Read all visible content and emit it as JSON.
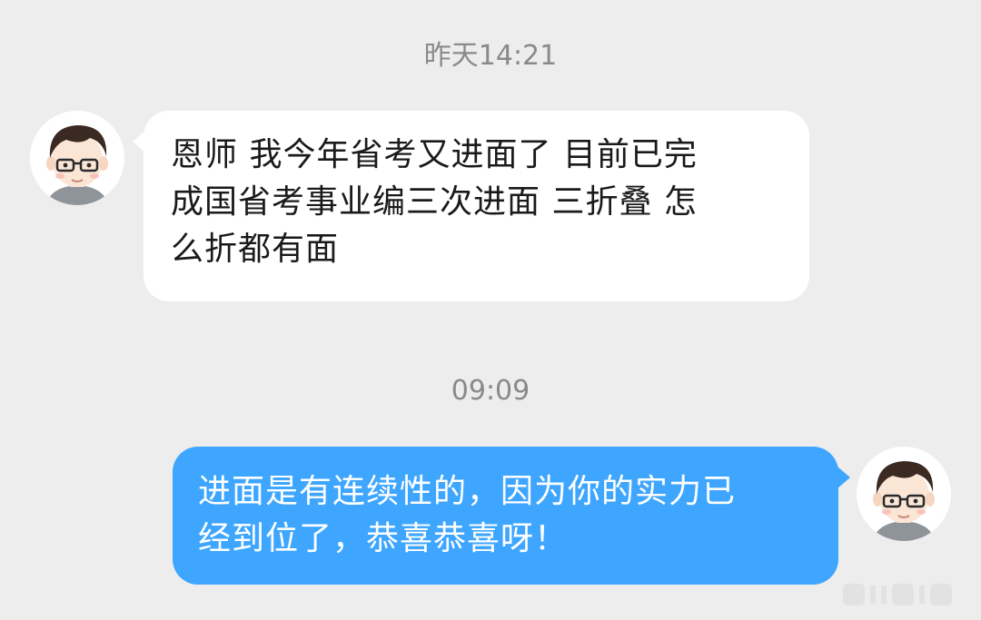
{
  "chat": {
    "timestamp_1": "昨天14:21",
    "incoming_message": {
      "lines": [
        "恩师 我今年省考又进面了 目前已完",
        "成国省考事业编三次进面 三折叠 怎",
        "么折都有面"
      ]
    },
    "timestamp_2": "09:09",
    "outgoing_message": {
      "lines": [
        "进面是有连续性的，因为你的实力已",
        "经到位了，恭喜恭喜呀！"
      ]
    }
  },
  "icons": {
    "avatar_left": "cartoon-man-with-glasses-avatar",
    "avatar_right": "cartoon-man-with-glasses-avatar",
    "watermark": "weibo-watermark-logo"
  },
  "colors": {
    "background": "#ededed",
    "incoming_bubble": "#ffffff",
    "outgoing_bubble": "#3ea6ff",
    "timestamp_text": "#8a8a8a"
  }
}
